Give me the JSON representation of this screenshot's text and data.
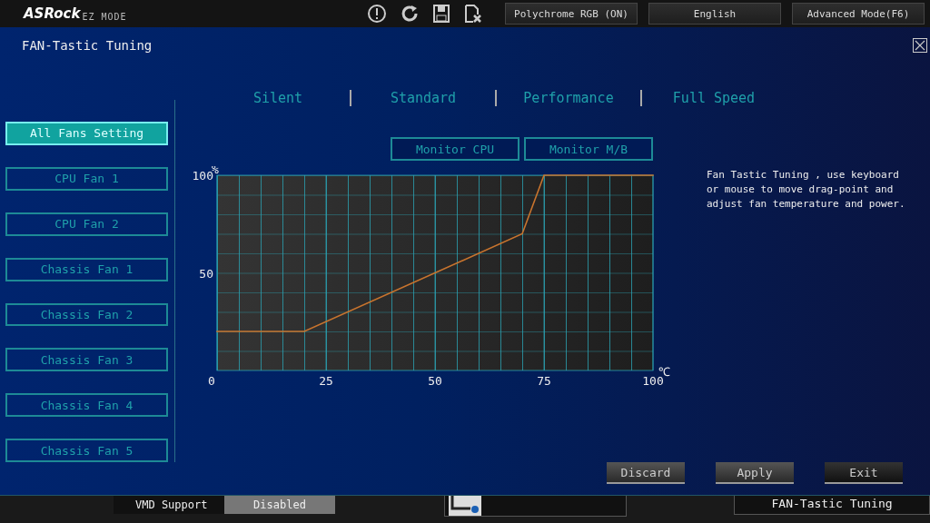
{
  "top_bar": {
    "logo": "ASRock",
    "mode": "EZ MODE",
    "buttons": [
      {
        "label": "Polychrome RGB (ON)"
      },
      {
        "label": "English"
      },
      {
        "label": "Advanced Mode(F6)"
      }
    ]
  },
  "window": {
    "title": "FAN-Tastic Tuning"
  },
  "presets": [
    {
      "label": "Silent"
    },
    {
      "label": "Standard"
    },
    {
      "label": "Performance"
    },
    {
      "label": "Full Speed"
    }
  ],
  "fans": [
    {
      "label": "All Fans Setting",
      "selected": true
    },
    {
      "label": "CPU Fan 1",
      "selected": false
    },
    {
      "label": "CPU Fan 2",
      "selected": false
    },
    {
      "label": "Chassis Fan 1",
      "selected": false
    },
    {
      "label": "Chassis Fan 2",
      "selected": false
    },
    {
      "label": "Chassis Fan 3",
      "selected": false
    },
    {
      "label": "Chassis Fan 4",
      "selected": false
    },
    {
      "label": "Chassis Fan 5",
      "selected": false
    }
  ],
  "monitor_buttons": [
    {
      "label": "Monitor CPU"
    },
    {
      "label": "Monitor M/B"
    }
  ],
  "chart_data": {
    "type": "line",
    "xlabel": "℃",
    "ylabel": "%",
    "x": [
      0,
      20,
      70,
      75,
      100
    ],
    "grid": true,
    "series": [
      {
        "color": "#c8742e",
        "values": [
          20,
          20,
          70,
          100,
          100
        ]
      }
    ],
    "xlim": [
      0,
      100
    ],
    "ylim": [
      0,
      100
    ],
    "xticks": [
      0,
      25,
      50,
      75,
      100
    ],
    "yticks": [
      50,
      100
    ]
  },
  "y_origin_label": "0",
  "description": "Fan Tastic Tuning , use keyboard or mouse to move drag-point and adjust fan temperature and power.",
  "actions": [
    {
      "label": "Discard"
    },
    {
      "label": "Apply"
    },
    {
      "label": "Exit"
    }
  ],
  "background": {
    "vmd_label": "VMD Support",
    "vmd_value": "Disabled",
    "tile": "FAN-Tastic Tuning"
  }
}
